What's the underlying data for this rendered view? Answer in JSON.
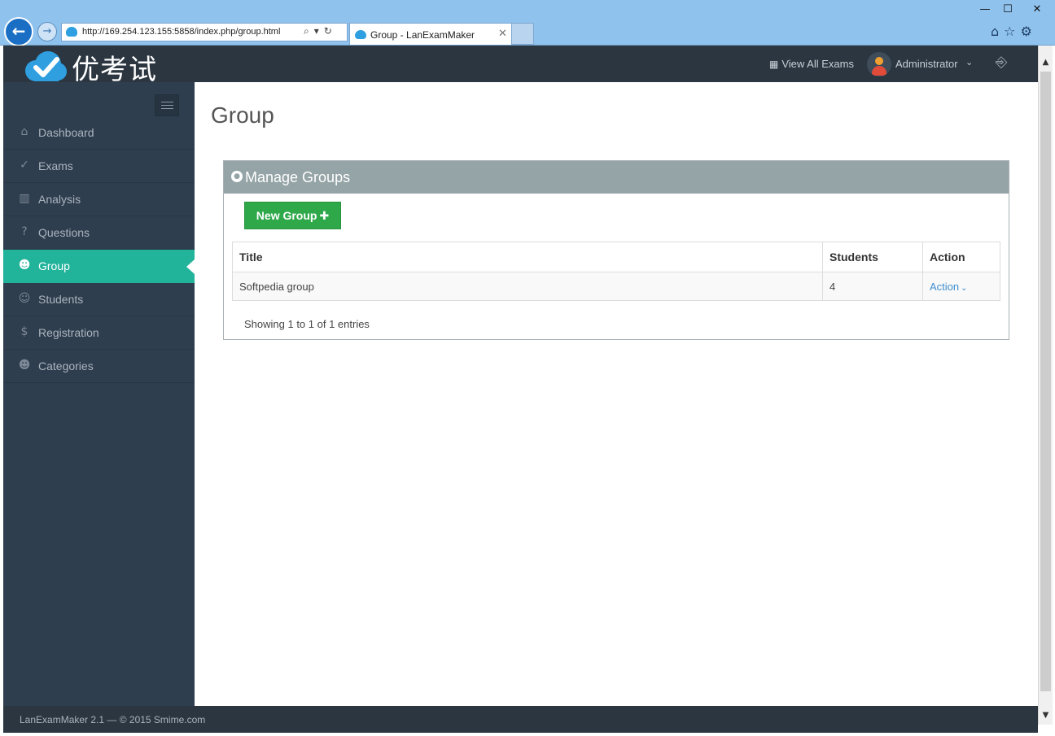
{
  "browser": {
    "url": "http://169.254.123.155:5858/index.php/group.html",
    "tab_title": "Group - LanExamMaker",
    "window_controls": {
      "minimize": "—",
      "maximize": "☐",
      "close": "✕"
    },
    "icons": [
      "back-arrow-icon",
      "forward-arrow-icon",
      "search-icon",
      "refresh-icon",
      "home-icon",
      "favorites-star-icon",
      "settings-gear-icon"
    ]
  },
  "header": {
    "logo_text": "优考试",
    "view_all_exams": "View All Exams",
    "user_name": "Administrator",
    "colors": {
      "header_bg": "#2b3641",
      "accent": "#22b39b"
    }
  },
  "sidebar": {
    "items": [
      {
        "label": "Dashboard",
        "icon": "home-icon",
        "active": false
      },
      {
        "label": "Exams",
        "icon": "check-circle-icon",
        "active": false
      },
      {
        "label": "Analysis",
        "icon": "bar-chart-icon",
        "active": false
      },
      {
        "label": "Questions",
        "icon": "question-circle-icon",
        "active": false
      },
      {
        "label": "Group",
        "icon": "users-icon",
        "active": true
      },
      {
        "label": "Students",
        "icon": "user-icon",
        "active": false
      },
      {
        "label": "Registration",
        "icon": "dollar-icon",
        "active": false
      },
      {
        "label": "Categories",
        "icon": "users-icon",
        "active": false
      }
    ]
  },
  "main": {
    "page_title": "Group",
    "panel_title": "Manage Groups",
    "new_group_label": "New Group",
    "new_group_color": "#2fa84a",
    "table": {
      "columns": [
        "Title",
        "Students",
        "Action"
      ],
      "rows": [
        {
          "title": "Softpedia group",
          "students": "4",
          "action": "Action"
        }
      ]
    },
    "table_info": "Showing 1 to 1 of 1 entries"
  },
  "footer": {
    "text": "LanExamMaker 2.1 — © 2015 Smime.com"
  }
}
